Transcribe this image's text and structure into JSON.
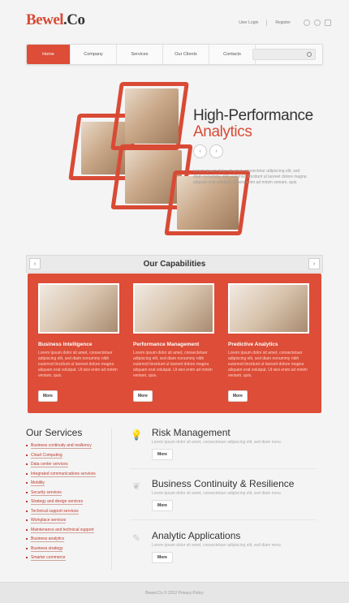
{
  "header": {
    "logo_main": "Bewel",
    "logo_dot": ".Co",
    "user_login": "User Login",
    "register": "Register",
    "social_icons": [
      "globe-icon",
      "twitter-icon",
      "rss-icon"
    ]
  },
  "nav": {
    "items": [
      "Home",
      "Company",
      "Services",
      "Our Clients",
      "Contacts"
    ],
    "search_placeholder": ""
  },
  "hero": {
    "headline_line1": "High-Performance",
    "headline_line2": "Analytics",
    "description": "Lorem ipsum dolor sit amet, consectetur adipiscing elit, sed diam nonummy nibh euismod tincidunt ut laoreet dolore magna aliquam erat volutpat. Ut wisi enim ad minim veniam, quis.",
    "prev_arrow": "‹",
    "next_arrow": "›"
  },
  "capabilities": {
    "title": "Our Capabilities",
    "prev_arrow": "‹",
    "next_arrow": "›",
    "cards": [
      {
        "title": "Business Intelligence",
        "text": "Lorem ipsum dolor sit amet, consectetuer adipiscing elit, sed diam nonummy nibh euismod tincidunt ut laoreet dolore magna aliquam erat volutpat. Ut wisi enim ad minim veniam, quis.",
        "button": "More"
      },
      {
        "title": "Performance Management",
        "text": "Lorem ipsum dolor sit amet, consectetuer adipiscing elit, sed diam nonummy nibh euismod tincidunt ut laoreet dolore magna aliquam erat volutpat. Ut wisi enim ad minim veniam, quis.",
        "button": "More"
      },
      {
        "title": "Predictive Analytics",
        "text": "Lorem ipsum dolor sit amet, consectetuer adipiscing elit, sed diam nonummy nibh euismod tincidunt ut laoreet dolore magna aliquam erat volutpat. Ut wisi enim ad minim veniam, quis.",
        "button": "More"
      }
    ]
  },
  "services": {
    "title": "Our Services",
    "items": [
      "Business continuity and resiliency",
      "Cloud Computing",
      "Data center services",
      "Integrated communications services",
      "Mobility",
      "Security services",
      "Strategy and design services",
      "Technical support services",
      "Workplace services",
      "Maintenance and technical support",
      "Business analytics",
      "Business strategy",
      "Smarter commerce"
    ]
  },
  "features": [
    {
      "icon": "lightbulb-icon",
      "title": "Risk Management",
      "desc": "Lorem ipsum dolor sit amet, consectetuer adipiscing elit, sed diam nonu.",
      "button": "More"
    },
    {
      "icon": "leaf-icon",
      "title": "Business Continuity & Resilience",
      "desc": "Lorem ipsum dolor sit amet, consectetuer adipiscing elit, sed diam nonu.",
      "button": "More"
    },
    {
      "icon": "edit-icon",
      "title": "Analytic Applications",
      "desc": "Lorem ipsum dolor sit amet, consectetuer adipiscing elit, sed diam nonu.",
      "button": "More"
    }
  ],
  "footer": {
    "text": "Bewel.Co © 2012 Privacy Policy"
  },
  "colors": {
    "accent": "#dd4d37",
    "background": "#f4f4f4"
  }
}
